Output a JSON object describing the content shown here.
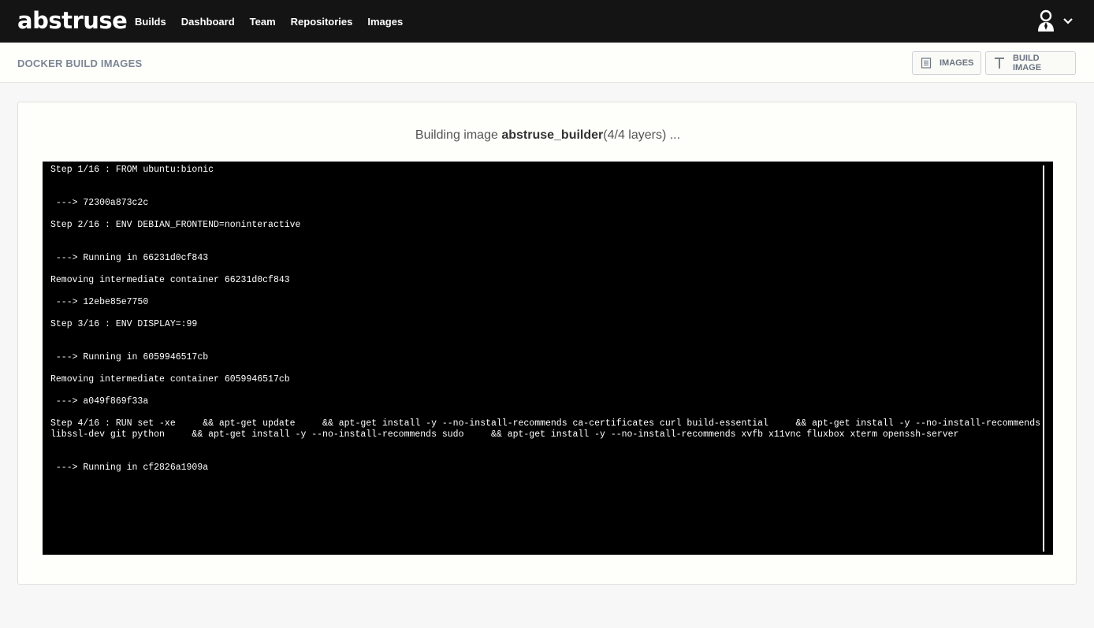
{
  "app": {
    "logo": "abstruse"
  },
  "nav": {
    "items": [
      {
        "label": "Builds"
      },
      {
        "label": "Dashboard"
      },
      {
        "label": "Team"
      },
      {
        "label": "Repositories"
      },
      {
        "label": "Images"
      }
    ],
    "user_icon": "user-avatar-icon",
    "dropdown_icon": "chevron-down-icon"
  },
  "header": {
    "title": "DOCKER BUILD IMAGES",
    "buttons": [
      {
        "label": "IMAGES",
        "icon": "list-icon"
      },
      {
        "label": "BUILD IMAGE",
        "icon": "text-t-icon"
      }
    ]
  },
  "build": {
    "prefix": "Building image ",
    "image_name": "abstruse_builder",
    "suffix": "(4/4 layers) ..."
  },
  "terminal": {
    "lines": [
      "Step 1/16 : FROM ubuntu:bionic",
      " ---> 72300a873c2c",
      "Step 2/16 : ENV DEBIAN_FRONTEND=noninteractive",
      " ---> Running in 66231d0cf843",
      "Removing intermediate container 66231d0cf843",
      " ---> 12ebe85e7750",
      "Step 3/16 : ENV DISPLAY=:99",
      " ---> Running in 6059946517cb",
      "Removing intermediate container 6059946517cb",
      " ---> a049f869f33a",
      "Step 4/16 : RUN set -xe     && apt-get update     && apt-get install -y --no-install-recommends ca-certificates curl build-essential     && apt-get install -y --no-install-recommends libssl-dev git python     && apt-get install -y --no-install-recommends sudo     && apt-get install -y --no-install-recommends xvfb x11vnc fluxbox xterm openssh-server",
      " ---> Running in cf2826a1909a"
    ]
  },
  "colors": {
    "topbar": "#141414",
    "terminal_bg": "#000000",
    "terminal_fg": "#ffffff",
    "title_gray": "#7c8694"
  }
}
